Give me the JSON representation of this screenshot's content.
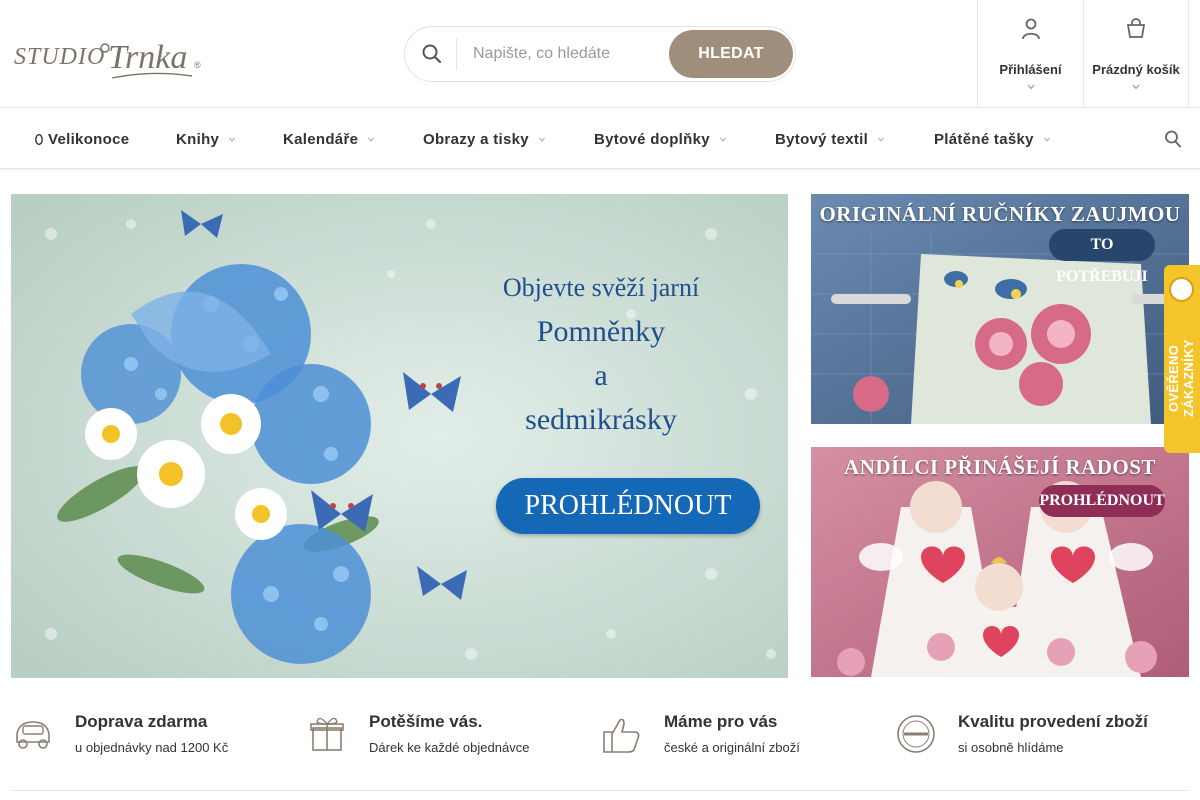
{
  "brand": {
    "logo_text_1": "STUDIO",
    "logo_text_2": "Trnka",
    "logo_mark": "®"
  },
  "search": {
    "placeholder": "Napište, co hledáte",
    "button_label": "HLEDAT"
  },
  "account": {
    "login_label": "Přihlášení",
    "cart_label": "Prázdný košík"
  },
  "nav": {
    "items": [
      {
        "label": "Velikonoce",
        "icon": "easter-egg-icon",
        "has_submenu": false
      },
      {
        "label": "Knihy",
        "has_submenu": true
      },
      {
        "label": "Kalendáře",
        "has_submenu": true
      },
      {
        "label": "Obrazy a tisky",
        "has_submenu": true
      },
      {
        "label": "Bytové doplňky",
        "has_submenu": true
      },
      {
        "label": "Bytový textil",
        "has_submenu": true
      },
      {
        "label": "Plátěné tašky",
        "has_submenu": true
      }
    ]
  },
  "hero": {
    "line1": "Objevte svěží jarní",
    "line2": "Pomněnky",
    "line3": "a",
    "line4": "sedmikrásky",
    "cta": "PROHLÉDNOUT"
  },
  "side_banners": [
    {
      "title": "ORIGINÁLNÍ RUČNÍKY ZAUJMOU",
      "cta": "TO POTŘEBUJI"
    },
    {
      "title": "ANDÍLCI PŘINÁŠEJÍ RADOST",
      "cta": "PROHLÉDNOUT"
    }
  ],
  "verified_badge": {
    "label": "OVĚŘENO ZÁKAZNÍKY",
    "color": "#f4c42b"
  },
  "benefits": [
    {
      "icon": "car-icon",
      "title": "Doprava zdarma",
      "subtitle": "u objednávky nad 1200 Kč"
    },
    {
      "icon": "gift-icon",
      "title": "Potěšíme vás.",
      "subtitle": "Dárek ke každé objednávce"
    },
    {
      "icon": "thumbs-up-icon",
      "title": "Máme pro vás",
      "subtitle": "české a originální zboží"
    },
    {
      "icon": "quality-stamp-icon",
      "title": "Kvalitu provedení zboží",
      "subtitle": "si osobně hlídáme"
    }
  ],
  "colors": {
    "accent": "#a08e7d",
    "hero_text": "#1f4f8f",
    "hero_button": "#1468b6",
    "text": "#333333"
  }
}
